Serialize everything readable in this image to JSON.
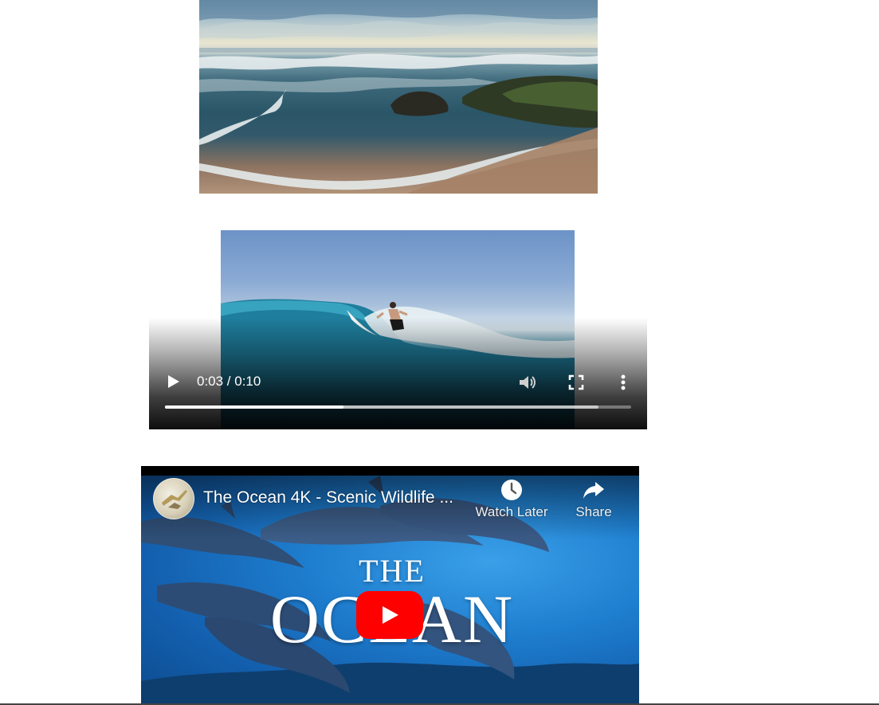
{
  "image": {
    "alt": ""
  },
  "video": {
    "time_display": "0:03 / 0:10",
    "progress_fraction": 0.383,
    "buffered_fraction": 0.93,
    "icons": {
      "play": "play-icon",
      "volume": "volume-icon",
      "fullscreen": "fullscreen-icon",
      "more": "more-options-icon"
    }
  },
  "youtube": {
    "title": "The Ocean 4K - Scenic Wildlife ...",
    "watch_later_label": "Watch Later",
    "share_label": "Share",
    "thumbnail_title_line1": "THE",
    "thumbnail_title_line2": "OCEAN",
    "colors": {
      "play_button": "#ff0000"
    }
  }
}
